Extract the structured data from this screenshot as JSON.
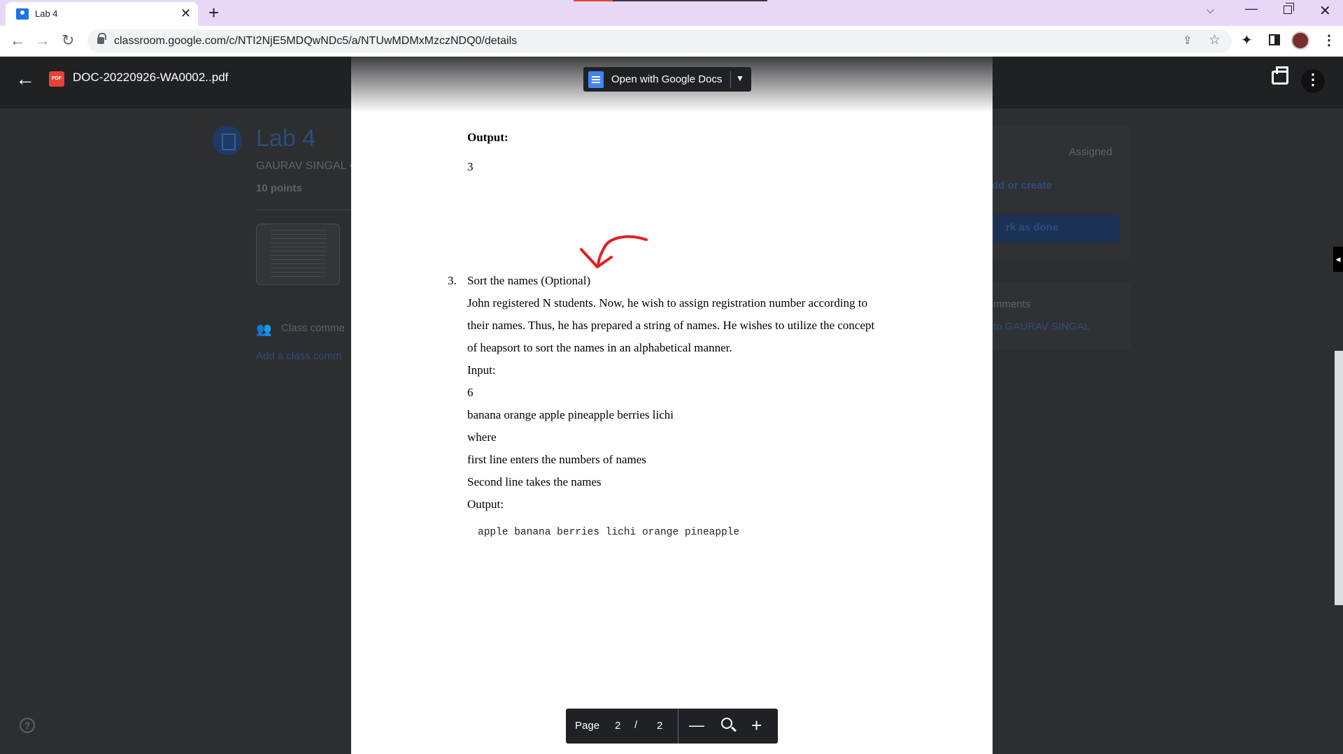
{
  "browser": {
    "tab_title": "Lab 4",
    "url": "classroom.google.com/c/NTI2NjE5MDQwNDc5/a/NTUwMDMxMzczNDQ0/details"
  },
  "viewer": {
    "file_name": "DOC-20220926-WA0002..pdf",
    "open_with_label": "Open with Google Docs",
    "page_label": "Page",
    "current_page": "2",
    "page_separator": "/",
    "total_pages": "2"
  },
  "classroom": {
    "title": "Lab 4",
    "teacher": "GAURAV SINGAL •",
    "points": "10 points",
    "class_comments": "Class comme",
    "add_class_comment": "Add a class comm",
    "status": "Assigned",
    "add_or_create": "dd or create",
    "mark_done": "rk as done",
    "private_comments": "mments",
    "private_add": "to GAURAV SINGAL"
  },
  "document": {
    "output_heading": "Output:",
    "output_value": "3",
    "item_number": "3.",
    "item_title": "Sort the names (Optional)",
    "para_lines": [
      "John registered N students. Now, he wish to assign registration number according to",
      "their names. Thus, he has prepared a string of names.  He wishes to utilize the concept",
      "of heapsort to sort the names in an alphabetical manner."
    ],
    "input_label": "Input:",
    "input_n": "6",
    "input_names": "banana orange apple pineapple berries lichi",
    "where": "where",
    "first_line_desc": "first line enters the numbers of names",
    "second_line_desc": "Second line takes the names",
    "output_label": "Output:",
    "output_sorted": "apple banana berries lichi orange pineapple"
  },
  "colors": {
    "tab_strip": "#e8d8f8",
    "annotation": "#e02020",
    "pdf_badge": "#e94235",
    "docs_blue": "#4285f4"
  }
}
